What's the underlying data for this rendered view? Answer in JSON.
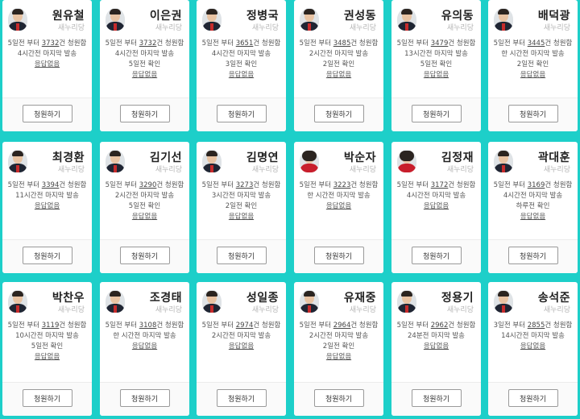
{
  "button_label": "청원하기",
  "accent_color": "#1dcfc9",
  "cards": [
    {
      "name": "원유철",
      "party": "새누리당",
      "text_pre": "5일전 부터 ",
      "count": "3732",
      "text_post": "건 청원함",
      "line2": "4시간전 마지막 발송",
      "line3": "",
      "no_reply": "응답없음",
      "avatar_icon": "person-photo"
    },
    {
      "name": "이은권",
      "party": "새누리당",
      "text_pre": "5일전 부터 ",
      "count": "3732",
      "text_post": "건 청원함",
      "line2": "4시간전 마지막 발송",
      "line3": "5일전 확인",
      "no_reply": "응답없음",
      "avatar_icon": "person-photo"
    },
    {
      "name": "정병국",
      "party": "새누리당",
      "text_pre": "5일전 부터 ",
      "count": "3651",
      "text_post": "건 청원함",
      "line2": "4시간전 마지막 발송",
      "line3": "3일전 확인",
      "no_reply": "응답없음",
      "avatar_icon": "person-photo"
    },
    {
      "name": "권성동",
      "party": "새누리당",
      "text_pre": "5일전 부터 ",
      "count": "3485",
      "text_post": "건 청원함",
      "line2": "2시간전 마지막 발송",
      "line3": "2일전 확인",
      "no_reply": "응답없음",
      "avatar_icon": "person-photo"
    },
    {
      "name": "유의동",
      "party": "새누리당",
      "text_pre": "5일전 부터 ",
      "count": "3479",
      "text_post": "건 청원함",
      "line2": "13시간전 마지막 발송",
      "line3": "5일전 확인",
      "no_reply": "응답없음",
      "avatar_icon": "person-photo"
    },
    {
      "name": "배덕광",
      "party": "새누리당",
      "text_pre": "5일전 부터 ",
      "count": "3445",
      "text_post": "건 청원함",
      "line2": "한 시간전 마지막 발송",
      "line3": "2일전 확인",
      "no_reply": "응답없음",
      "avatar_icon": "person-photo"
    },
    {
      "name": "최경환",
      "party": "새누리당",
      "text_pre": "5일전 부터 ",
      "count": "3394",
      "text_post": "건 청원함",
      "line2": "11시간전 마지막 발송",
      "line3": "",
      "no_reply": "응답없음",
      "avatar_icon": "person-photo"
    },
    {
      "name": "김기선",
      "party": "새누리당",
      "text_pre": "5일전 부터 ",
      "count": "3290",
      "text_post": "건 청원함",
      "line2": "2시간전 마지막 발송",
      "line3": "5일전 확인",
      "no_reply": "응답없음",
      "avatar_icon": "person-photo"
    },
    {
      "name": "김명연",
      "party": "새누리당",
      "text_pre": "5일전 부터 ",
      "count": "3273",
      "text_post": "건 청원함",
      "line2": "3시간전 마지막 발송",
      "line3": "2일전 확인",
      "no_reply": "응답없음",
      "avatar_icon": "person-photo"
    },
    {
      "name": "박순자",
      "party": "새누리당",
      "text_pre": "5일전 부터 ",
      "count": "3223",
      "text_post": "건 청원함",
      "line2": "한 시간전 마지막 발송",
      "line3": "",
      "no_reply": "응답없음",
      "avatar_icon": "person-photo-female"
    },
    {
      "name": "김정재",
      "party": "새누리당",
      "text_pre": "5일전 부터 ",
      "count": "3172",
      "text_post": "건 청원함",
      "line2": "4시간전 마지막 발송",
      "line3": "",
      "no_reply": "응답없음",
      "avatar_icon": "person-photo-female"
    },
    {
      "name": "곽대훈",
      "party": "새누리당",
      "text_pre": "5일전 부터 ",
      "count": "3169",
      "text_post": "건 청원함",
      "line2": "4시간전 마지막 발송",
      "line3": "하루전 확인",
      "no_reply": "응답없음",
      "avatar_icon": "person-photo"
    },
    {
      "name": "박찬우",
      "party": "새누리당",
      "text_pre": "5일전 부터 ",
      "count": "3119",
      "text_post": "건 청원함",
      "line2": "10시간전 마지막 발송",
      "line3": "5일전 확인",
      "no_reply": "응답없음",
      "avatar_icon": "person-photo"
    },
    {
      "name": "조경태",
      "party": "새누리당",
      "text_pre": "5일전 부터 ",
      "count": "3108",
      "text_post": "건 청원함",
      "line2": "한 시간전 마지막 발송",
      "line3": "",
      "no_reply": "응답없음",
      "avatar_icon": "person-photo"
    },
    {
      "name": "성일종",
      "party": "새누리당",
      "text_pre": "5일전 부터 ",
      "count": "2974",
      "text_post": "건 청원함",
      "line2": "2시간전 마지막 발송",
      "line3": "",
      "no_reply": "응답없음",
      "avatar_icon": "person-photo"
    },
    {
      "name": "유재중",
      "party": "새누리당",
      "text_pre": "5일전 부터 ",
      "count": "2964",
      "text_post": "건 청원함",
      "line2": "2시간전 마지막 발송",
      "line3": "2일전 확인",
      "no_reply": "응답없음",
      "avatar_icon": "person-photo"
    },
    {
      "name": "정용기",
      "party": "새누리당",
      "text_pre": "5일전 부터 ",
      "count": "2962",
      "text_post": "건 청원함",
      "line2": "24분전 마지막 발송",
      "line3": "",
      "no_reply": "응답없음",
      "avatar_icon": "person-photo"
    },
    {
      "name": "송석준",
      "party": "새누리당",
      "text_pre": "3일전 부터 ",
      "count": "2855",
      "text_post": "건 청원함",
      "line2": "14시간전 마지막 발송",
      "line3": "",
      "no_reply": "응답없음",
      "avatar_icon": "person-photo"
    }
  ]
}
